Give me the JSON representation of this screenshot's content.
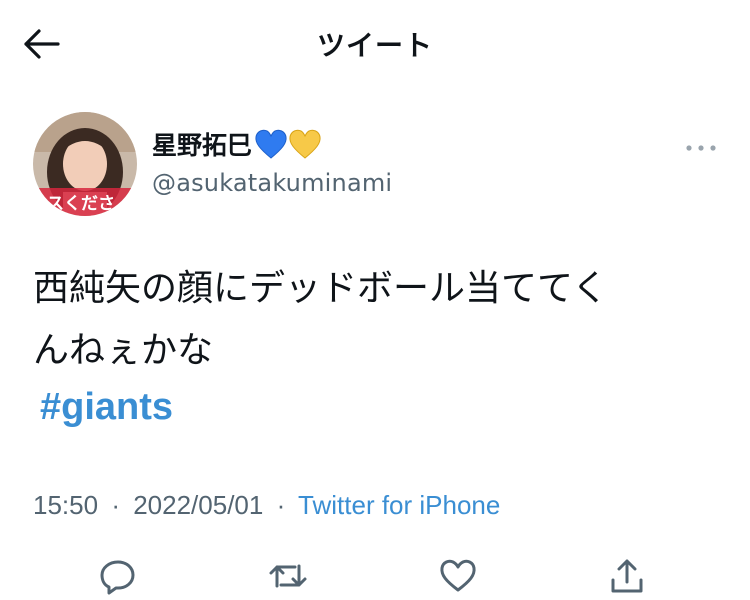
{
  "header": {
    "title": "ツイート",
    "back_icon": "arrow-left-icon"
  },
  "author": {
    "display_name": "星野拓巳",
    "emoji": [
      "blue-heart",
      "yellow-heart"
    ],
    "username": "@asukatakuminami",
    "avatar_caption": "スくださ"
  },
  "tweet": {
    "line1": "西純矢の顔にデッドボール当ててく",
    "line2": "んねぇかな",
    "hashtag": "#giants"
  },
  "meta": {
    "time": "15:50",
    "date": "2022/05/01",
    "separator": "·",
    "source": "Twitter for iPhone"
  },
  "actions": [
    "reply-icon",
    "retweet-icon",
    "like-icon",
    "share-icon"
  ],
  "colors": {
    "accent": "#3a8ed3",
    "secondary_text": "#536471",
    "primary_text": "#0f1419"
  }
}
